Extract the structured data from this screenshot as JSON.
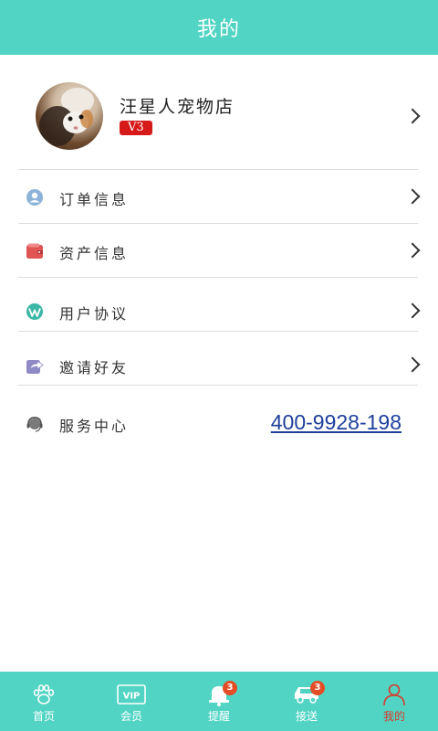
{
  "header": {
    "title": "我的"
  },
  "profile": {
    "shop_name": "汪星人宠物店",
    "level": "V3"
  },
  "menu": {
    "items": [
      {
        "label": "订单信息",
        "icon": "user-icon"
      },
      {
        "label": "资产信息",
        "icon": "wallet-icon"
      },
      {
        "label": "用户协议",
        "icon": "wordpress-icon"
      },
      {
        "label": "邀请好友",
        "icon": "share-icon"
      }
    ],
    "service": {
      "label": "服务中心",
      "phone": "400-9928-198",
      "icon": "headset-icon"
    }
  },
  "tabs": [
    {
      "label": "首页",
      "icon": "paw-icon",
      "badge": null,
      "active": false
    },
    {
      "label": "会员",
      "icon": "vip-card-icon",
      "badge": null,
      "active": false
    },
    {
      "label": "提醒",
      "icon": "bell-icon",
      "badge": "3",
      "active": false
    },
    {
      "label": "接送",
      "icon": "car-icon",
      "badge": "3",
      "active": false
    },
    {
      "label": "我的",
      "icon": "person-icon",
      "badge": null,
      "active": true
    }
  ],
  "colors": {
    "brand": "#52d4c4",
    "badge": "#d61a1a",
    "link": "#1f3f9a",
    "active_tab": "#d63a2b"
  }
}
